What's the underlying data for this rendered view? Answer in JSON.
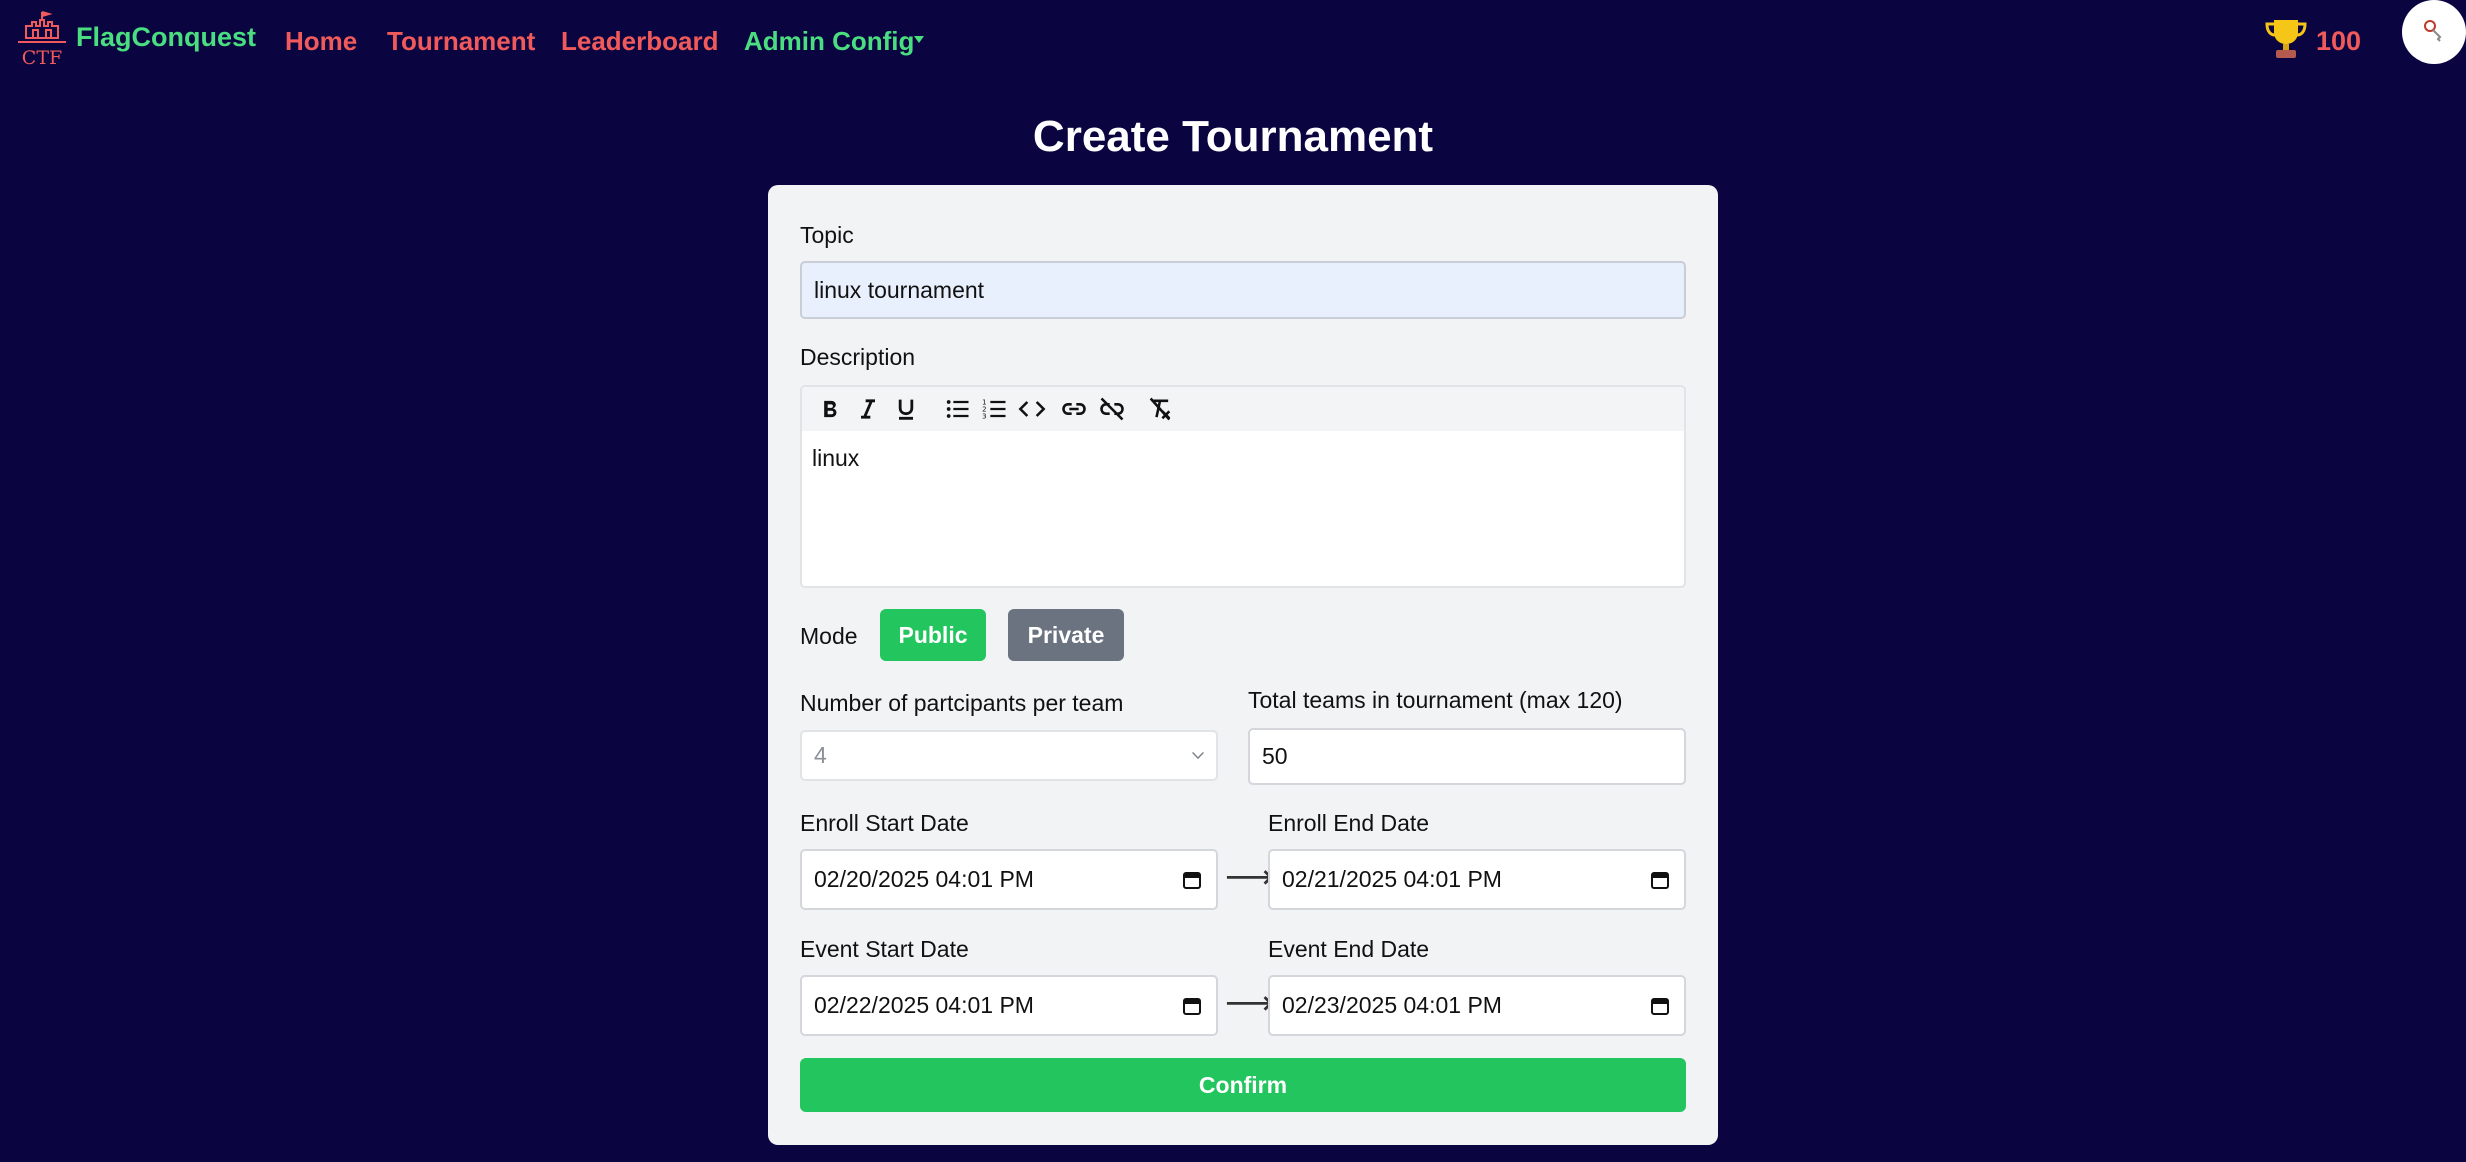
{
  "nav": {
    "brand": "FlagConquest",
    "logo_text": "CTF",
    "links": [
      "Home",
      "Tournament",
      "Leaderboard",
      "Admin Config"
    ],
    "score": "100"
  },
  "page": {
    "title": "Create Tournament"
  },
  "form": {
    "topic_label": "Topic",
    "topic_value": "linux tournament",
    "description_label": "Description",
    "description_value": "linux",
    "toolbar_icons": [
      "bold-icon",
      "italic-icon",
      "underline-icon",
      "bullet-list-icon",
      "numbered-list-icon",
      "code-icon",
      "link-icon",
      "unlink-icon",
      "clear-format-icon"
    ],
    "mode_label": "Mode",
    "mode_public": "Public",
    "mode_private": "Private",
    "mode_selected": "Public",
    "participants_label": "Number of partcipants per team",
    "participants_value": "4",
    "teams_label": "Total teams in tournament (max 120)",
    "teams_value": "50",
    "enroll_start_label": "Enroll Start Date",
    "enroll_start_value": "02/20/2025 04:01 PM",
    "enroll_end_label": "Enroll End Date",
    "enroll_end_value": "02/21/2025 04:01 PM",
    "event_start_label": "Event Start Date",
    "event_start_value": "02/22/2025 04:01 PM",
    "event_end_label": "Event End Date",
    "event_end_value": "02/23/2025 04:01 PM",
    "arrow": "⟶",
    "confirm_label": "Confirm"
  },
  "colors": {
    "background": "#0a0540",
    "accent_green": "#22c55e",
    "nav_red": "#f05a5a",
    "nav_green": "#4ade80",
    "private_gray": "#6b7280"
  }
}
